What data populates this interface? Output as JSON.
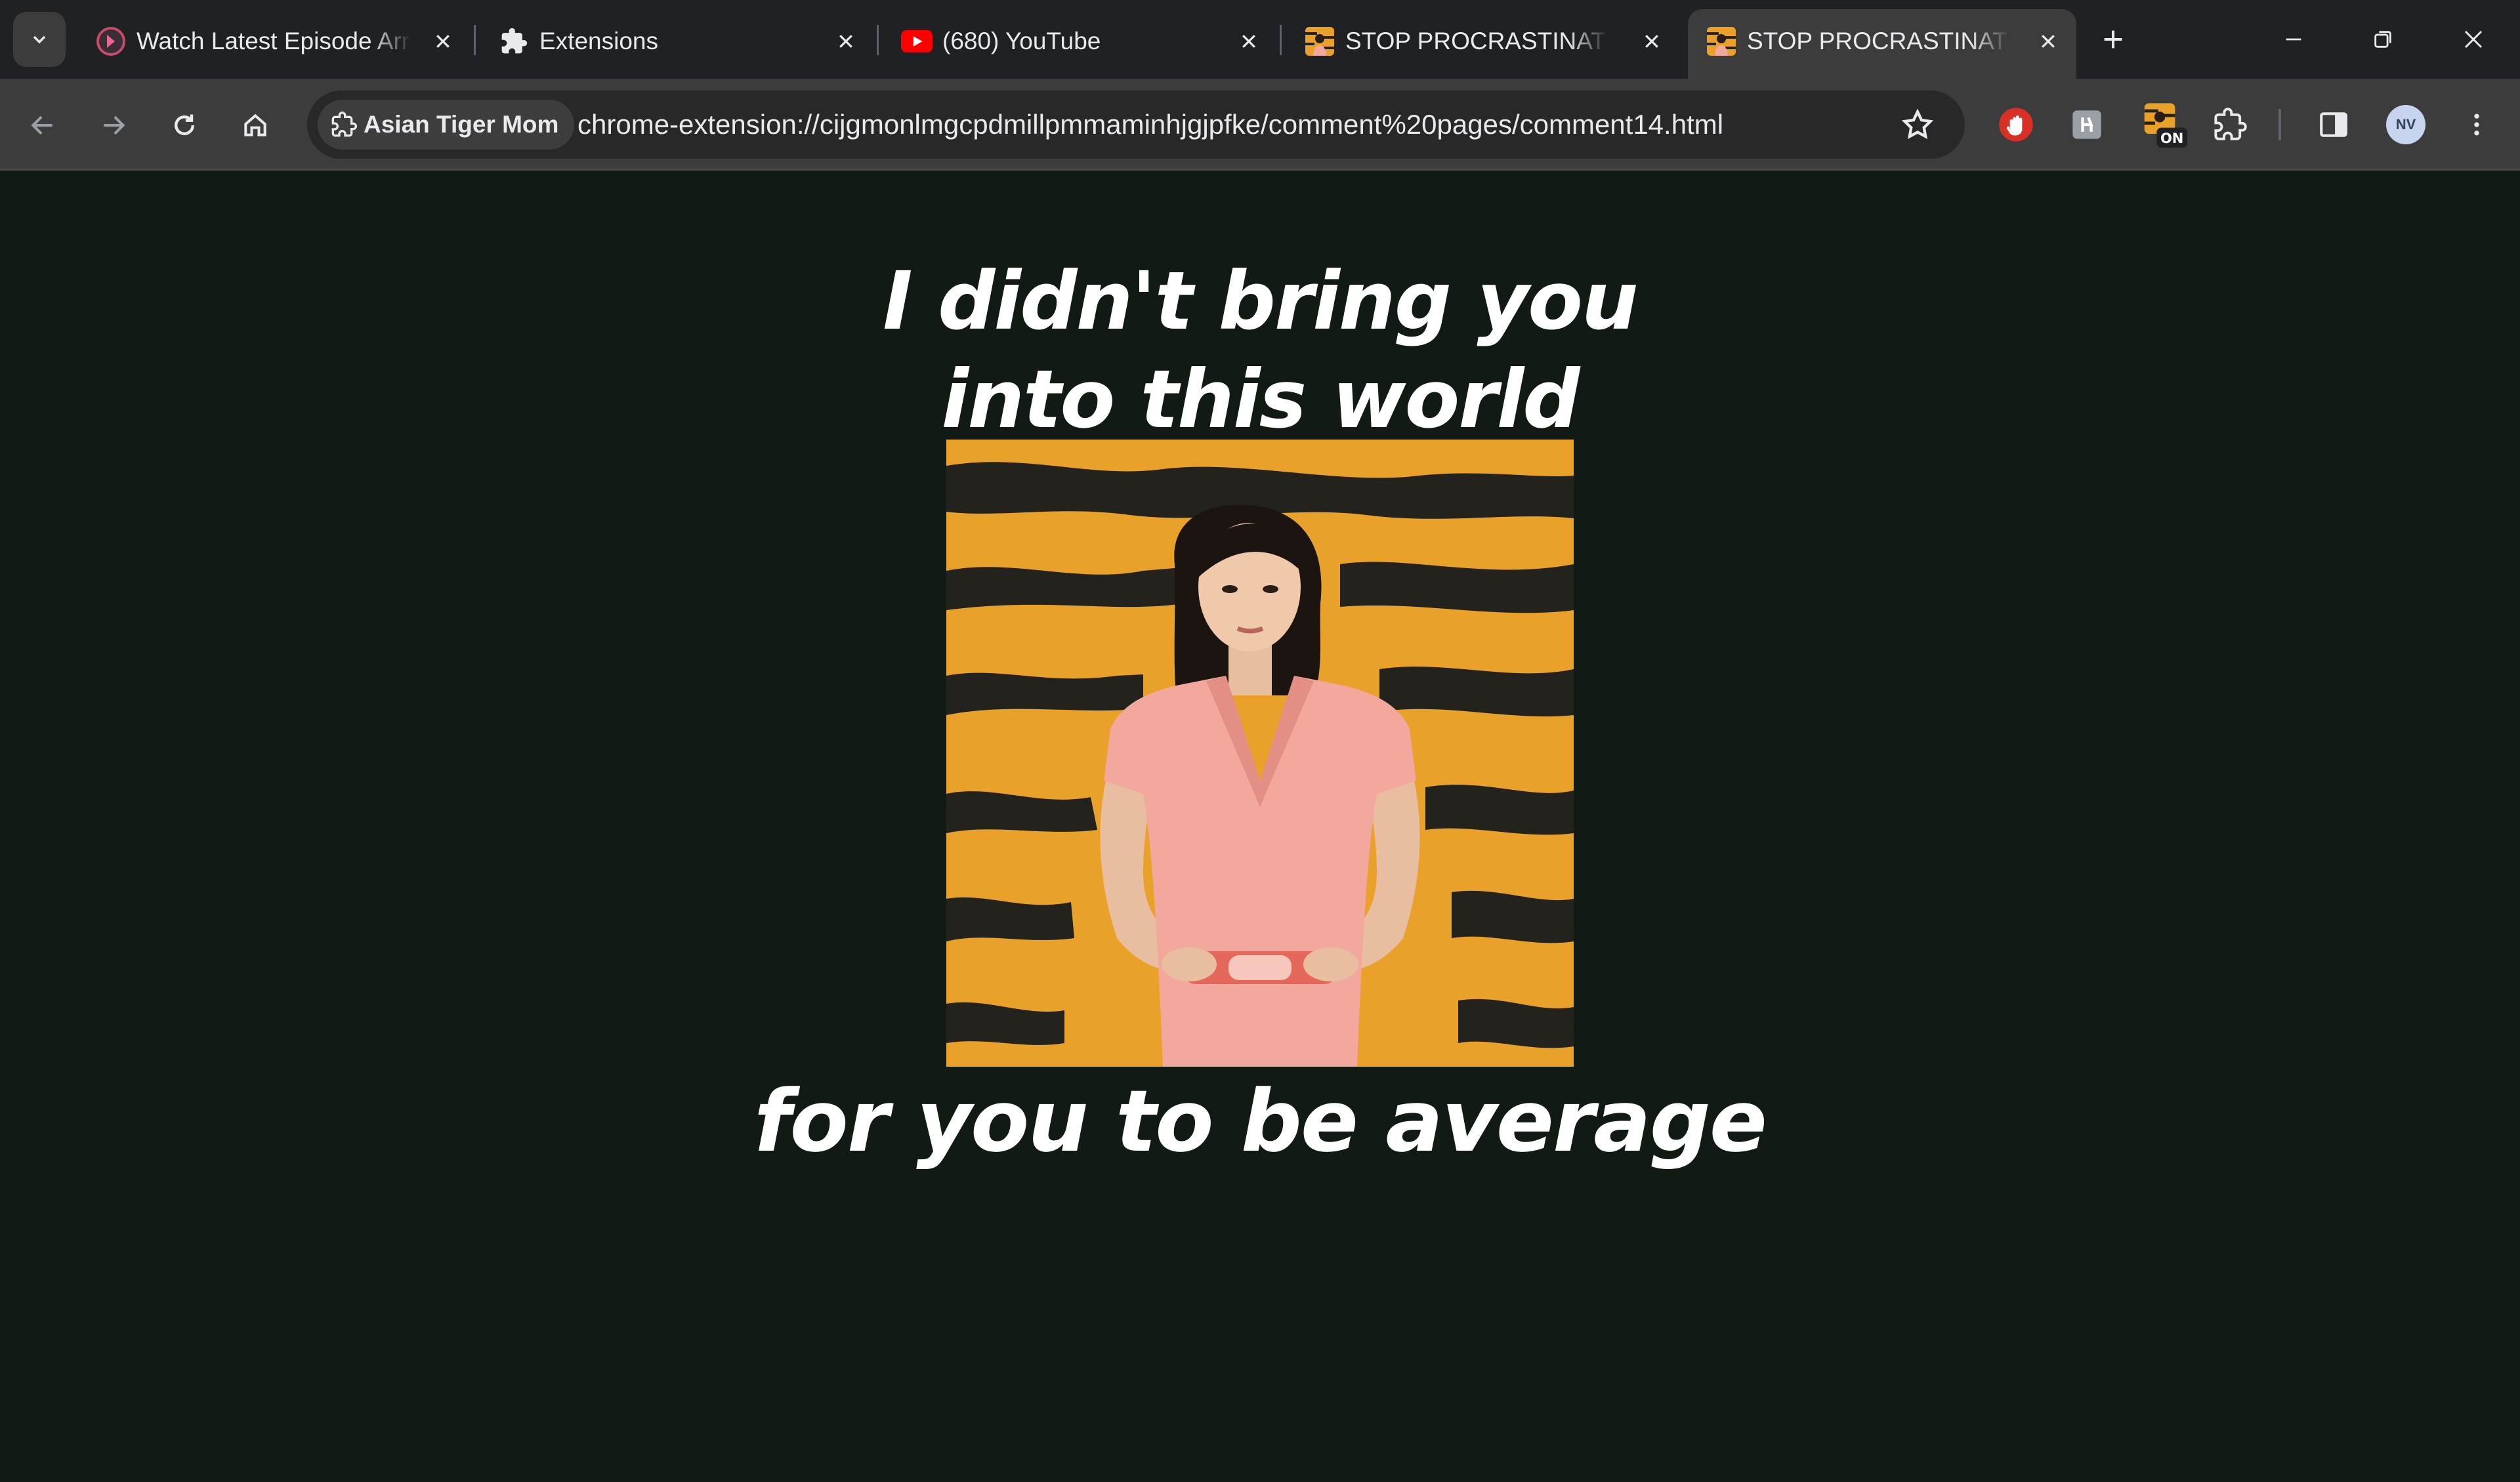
{
  "browser": {
    "tabs": [
      {
        "title": "Watch Latest Episode Arr",
        "favicon": "anime-site-icon",
        "active": false
      },
      {
        "title": "Extensions",
        "favicon": "puzzle-icon",
        "active": false
      },
      {
        "title": "(680) YouTube",
        "favicon": "youtube-icon",
        "active": false
      },
      {
        "title": "STOP PROCRASTINATING",
        "favicon": "tiger-mom-icon",
        "active": false
      },
      {
        "title": "STOP PROCRASTINATING",
        "favicon": "tiger-mom-icon",
        "active": true
      }
    ],
    "toolbar": {
      "site_chip": "Asian Tiger Mom",
      "url": "chrome-extension://cijgmonlmgcpdmillpmmaminhjgjpfke/comment%20pages/comment14.html",
      "extension_badge": "ON",
      "avatar_initials": "NV"
    }
  },
  "page": {
    "heading_line1": "I didn't bring you",
    "heading_line2": "into this world",
    "heading_bottom": "for you to be average",
    "image": "woman in pink dress with hands on hips in front of tiger-stripe background"
  },
  "colors": {
    "page_background": "#121a14",
    "heading_text": "#ffffff",
    "tiger_orange": "#e9a12a",
    "tiger_stripe": "#23221c",
    "dress_pink": "#f2a89c"
  }
}
